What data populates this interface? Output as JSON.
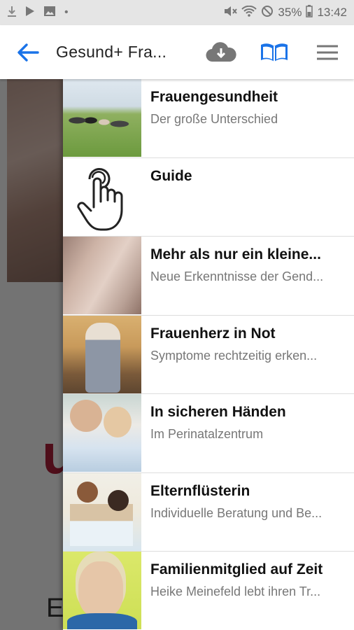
{
  "status_bar": {
    "battery": "35%",
    "time": "13:42",
    "icons_left": [
      "download-icon",
      "play-store-icon",
      "gallery-icon",
      "dot-icon"
    ],
    "icons_right": [
      "mute-icon",
      "wifi-icon",
      "no-sim-icon",
      "battery-icon"
    ]
  },
  "app_bar": {
    "title": "Gesund+ Fra...",
    "back_icon": "arrow-back-icon",
    "actions": [
      "cloud-download-icon",
      "book-icon",
      "menu-icon"
    ],
    "accent": "#1a73e8"
  },
  "background_page": {
    "partial_text_1": "u",
    "partial_text_2": "E"
  },
  "drawer": {
    "items": [
      {
        "title": "Frauengesundheit",
        "subtitle": "Der große Unterschied",
        "thumb": "women-group-photo"
      },
      {
        "title": "Guide",
        "subtitle": "",
        "thumb": "tap-hand-icon"
      },
      {
        "title": "Mehr als nur ein kleine...",
        "subtitle": "Neue Erkenntnisse der Gend...",
        "thumb": "couple-photo"
      },
      {
        "title": "Frauenherz in Not",
        "subtitle": "Symptome rechtzeitig erken...",
        "thumb": "older-woman-bench-photo"
      },
      {
        "title": "In sicheren Händen",
        "subtitle": "Im Perinatalzentrum",
        "thumb": "parents-baby-photo"
      },
      {
        "title": "Elternflüsterin",
        "subtitle": "Individuelle Beratung und Be...",
        "thumb": "nurses-photo"
      },
      {
        "title": "Familienmitglied auf Zeit",
        "subtitle": "Heike Meinefeld lebt ihren Tr...",
        "thumb": "portrait-photo"
      }
    ]
  }
}
